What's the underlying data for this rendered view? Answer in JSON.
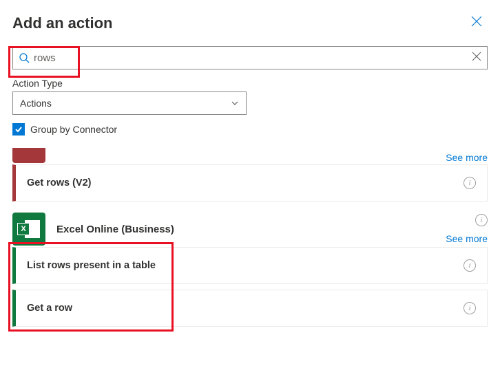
{
  "header": {
    "title": "Add an action"
  },
  "search": {
    "value": "rows"
  },
  "actionType": {
    "label": "Action Type",
    "selected": "Actions"
  },
  "groupBy": {
    "label": "Group by Connector",
    "checked": true
  },
  "seeMore": "See more",
  "connectors": {
    "partialActions": [
      {
        "title": "Get rows (V2)"
      }
    ],
    "excel": {
      "name": "Excel Online (Business)",
      "actions": [
        {
          "title": "List rows present in a table"
        },
        {
          "title": "Get a row"
        }
      ]
    }
  }
}
